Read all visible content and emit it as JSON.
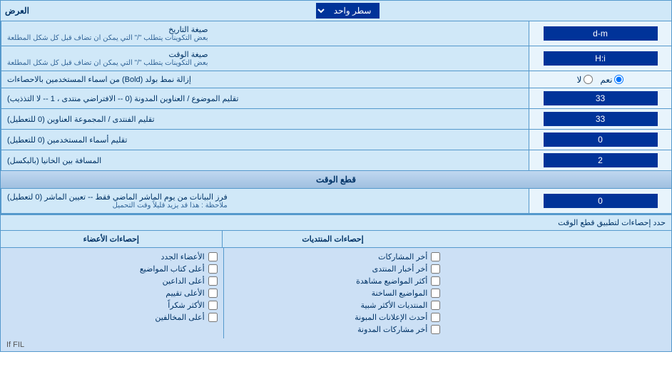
{
  "header": {
    "right_label": "العرض",
    "dropdown_label": "سطر واحد"
  },
  "rows": [
    {
      "id": "date_format",
      "label": "صيغة التاريخ",
      "sub_label": "بعض التكوينات يتطلب \"/\" التي يمكن ان تضاف قبل كل شكل المطلعة",
      "input_value": "d-m",
      "input_type": "text"
    },
    {
      "id": "time_format",
      "label": "صيغة الوقت",
      "sub_label": "بعض التكوينات يتطلب \"/\" التي يمكن ان تضاف قبل كل شكل المطلعة",
      "input_value": "H:i",
      "input_type": "text"
    },
    {
      "id": "bold_remove",
      "label": "إزالة نمط بولد (Bold) من اسماء المستخدمين بالاحصاءات",
      "input_type": "radio",
      "radio_options": [
        "نعم",
        "لا"
      ],
      "selected": "نعم"
    },
    {
      "id": "topic_order",
      "label": "تقليم الموضوع / العناوين المدونة (0 -- الافتراضي منتدى ، 1 -- لا التذذيب)",
      "input_value": "33",
      "input_type": "text"
    },
    {
      "id": "forum_order",
      "label": "تقليم الفنتدى / المجموعة العناوين (0 للتعطيل)",
      "input_value": "33",
      "input_type": "text"
    },
    {
      "id": "usernames_trim",
      "label": "تقليم أسماء المستخدمين (0 للتعطيل)",
      "input_value": "0",
      "input_type": "text"
    },
    {
      "id": "gap",
      "label": "المسافة بين الخانيا (بالبكسل)",
      "input_value": "2",
      "input_type": "text"
    }
  ],
  "section_cutoff": {
    "header": "قطع الوقت",
    "row": {
      "label": "فرز البيانات من يوم الماشر الماضي فقط -- تعيين الماشر (0 لتعطيل)",
      "sub_label": "ملاحظة : هذا قد يزيد قليلاً وقت التحميل",
      "input_value": "0"
    }
  },
  "stats": {
    "apply_label": "حدد إحصاءات لتطبيق قطع الوقت",
    "col1_header": "إحصاءات المنتديات",
    "col2_header": "إحصاءات الأعضاء",
    "col1_items": [
      "أخر المشاركات",
      "أخر أخبار المنتدى",
      "أكثر المواضيع مشاهدة",
      "المواضيع الساخنة",
      "المنتديات الأكثر شبية",
      "أحدث الإعلانات المبونة",
      "أخر مشاركات المدونة"
    ],
    "col2_items": [
      "الأعضاء الجدد",
      "أعلى كتاب المواضيع",
      "أعلى الداعين",
      "الأعلى تقييم",
      "الأكثر شكراً",
      "أعلى المخالفين"
    ]
  },
  "filter_text": "If FIL"
}
